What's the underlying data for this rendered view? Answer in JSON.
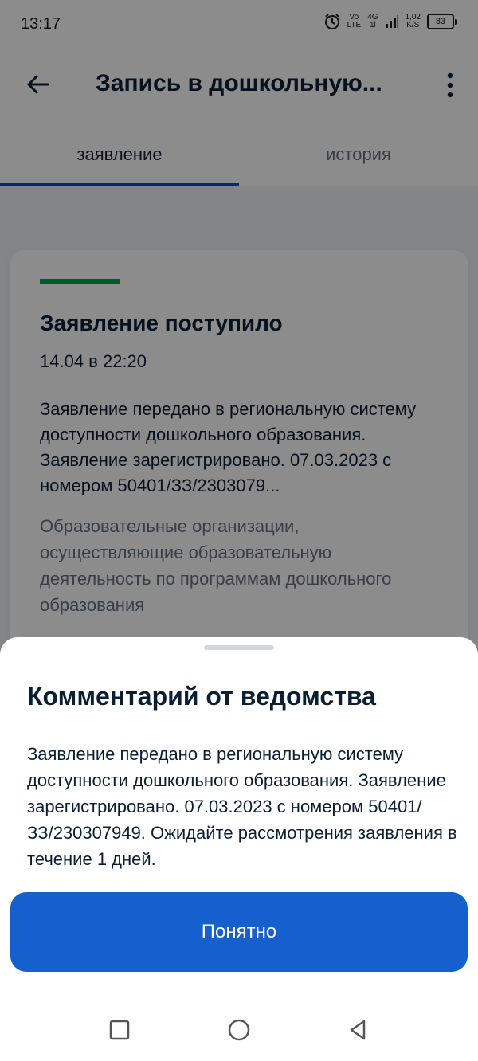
{
  "status_bar": {
    "time": "13:17",
    "network_top": "Vo",
    "network_bottom": "LTE",
    "signal_label_top": "4G",
    "signal_label_bottom": "1l",
    "speed_value": "1,02",
    "speed_unit": "K/S",
    "battery_level": "83",
    "icons": [
      "alarm-icon",
      "signal-icon",
      "battery-icon"
    ]
  },
  "header": {
    "title": "Запись в дошкольную...",
    "back_icon": "arrow-left-icon",
    "menu_icon": "kebab-menu-icon"
  },
  "tabs": [
    {
      "label": "заявление",
      "active": true
    },
    {
      "label": "история",
      "active": false
    }
  ],
  "card": {
    "accent_color": "#00A94F",
    "title": "Заявление поступило",
    "date": "14.04 в 22:20",
    "text": "Заявление передано в региональную систему доступности дошкольного образования. Заявление зарегистрировано. 07.03.2023 с номером 50401/ЗЗ/2303079...",
    "organization": "Образовательные организации, осуществляющие образовательную деятельность по программам дошкольного образования"
  },
  "sheet": {
    "title": "Комментарий от ведомства",
    "text": "Заявление передано в региональную систему доступности дошкольного образования. Заявление зарегистрировано. 07.03.2023 с номером 50401/ЗЗ/230307949. Ожидайте рассмотрения заявления в течение 1 дней.",
    "button_label": "Понятно",
    "button_color": "#1560CC"
  },
  "nav_bar": {
    "icons": [
      "recent-apps-icon",
      "home-icon",
      "back-triangle-icon"
    ]
  },
  "colors": {
    "primary_text": "#0B1F33",
    "secondary_text": "#66727F",
    "tab_indicator": "#0D4CD3"
  }
}
